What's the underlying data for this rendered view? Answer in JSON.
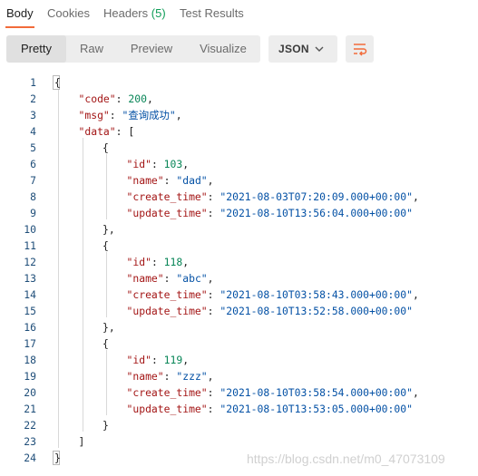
{
  "tabs": [
    {
      "label": "Body",
      "count": ""
    },
    {
      "label": "Cookies",
      "count": ""
    },
    {
      "label": "Headers",
      "count": "(5)"
    },
    {
      "label": "Test Results",
      "count": ""
    }
  ],
  "view_modes": [
    "Pretty",
    "Raw",
    "Preview",
    "Visualize"
  ],
  "active_view": "Pretty",
  "format_select": {
    "value": "JSON"
  },
  "icons": {
    "format_chevron": "chevron-down-icon",
    "wrap": "wrap-lines-icon"
  },
  "colors": {
    "accent": "#f26b3a",
    "count": "#0f9d58",
    "key": "#a31515",
    "string": "#0451a5",
    "number": "#098658"
  },
  "code_lines": [
    {
      "n": "1",
      "indent": 0,
      "tokens": [
        [
          "p",
          "{"
        ]
      ]
    },
    {
      "n": "2",
      "indent": 1,
      "tokens": [
        [
          "k",
          "\"code\""
        ],
        [
          "p",
          ": "
        ],
        [
          "n",
          "200"
        ],
        [
          "p",
          ","
        ]
      ]
    },
    {
      "n": "3",
      "indent": 1,
      "tokens": [
        [
          "k",
          "\"msg\""
        ],
        [
          "p",
          ": "
        ],
        [
          "s",
          "\"查询成功\""
        ],
        [
          "p",
          ","
        ]
      ]
    },
    {
      "n": "4",
      "indent": 1,
      "tokens": [
        [
          "k",
          "\"data\""
        ],
        [
          "p",
          ": ["
        ]
      ]
    },
    {
      "n": "5",
      "indent": 2,
      "tokens": [
        [
          "p",
          "{"
        ]
      ]
    },
    {
      "n": "6",
      "indent": 3,
      "tokens": [
        [
          "k",
          "\"id\""
        ],
        [
          "p",
          ": "
        ],
        [
          "n",
          "103"
        ],
        [
          "p",
          ","
        ]
      ]
    },
    {
      "n": "7",
      "indent": 3,
      "tokens": [
        [
          "k",
          "\"name\""
        ],
        [
          "p",
          ": "
        ],
        [
          "s",
          "\"dad\""
        ],
        [
          "p",
          ","
        ]
      ]
    },
    {
      "n": "8",
      "indent": 3,
      "tokens": [
        [
          "k",
          "\"create_time\""
        ],
        [
          "p",
          ": "
        ],
        [
          "s",
          "\"2021-08-03T07:20:09.000+00:00\""
        ],
        [
          "p",
          ","
        ]
      ]
    },
    {
      "n": "9",
      "indent": 3,
      "tokens": [
        [
          "k",
          "\"update_time\""
        ],
        [
          "p",
          ": "
        ],
        [
          "s",
          "\"2021-08-10T13:56:04.000+00:00\""
        ]
      ]
    },
    {
      "n": "10",
      "indent": 2,
      "tokens": [
        [
          "p",
          "},"
        ]
      ]
    },
    {
      "n": "11",
      "indent": 2,
      "tokens": [
        [
          "p",
          "{"
        ]
      ]
    },
    {
      "n": "12",
      "indent": 3,
      "tokens": [
        [
          "k",
          "\"id\""
        ],
        [
          "p",
          ": "
        ],
        [
          "n",
          "118"
        ],
        [
          "p",
          ","
        ]
      ]
    },
    {
      "n": "13",
      "indent": 3,
      "tokens": [
        [
          "k",
          "\"name\""
        ],
        [
          "p",
          ": "
        ],
        [
          "s",
          "\"abc\""
        ],
        [
          "p",
          ","
        ]
      ]
    },
    {
      "n": "14",
      "indent": 3,
      "tokens": [
        [
          "k",
          "\"create_time\""
        ],
        [
          "p",
          ": "
        ],
        [
          "s",
          "\"2021-08-10T03:58:43.000+00:00\""
        ],
        [
          "p",
          ","
        ]
      ]
    },
    {
      "n": "15",
      "indent": 3,
      "tokens": [
        [
          "k",
          "\"update_time\""
        ],
        [
          "p",
          ": "
        ],
        [
          "s",
          "\"2021-08-10T13:52:58.000+00:00\""
        ]
      ]
    },
    {
      "n": "16",
      "indent": 2,
      "tokens": [
        [
          "p",
          "},"
        ]
      ]
    },
    {
      "n": "17",
      "indent": 2,
      "tokens": [
        [
          "p",
          "{"
        ]
      ]
    },
    {
      "n": "18",
      "indent": 3,
      "tokens": [
        [
          "k",
          "\"id\""
        ],
        [
          "p",
          ": "
        ],
        [
          "n",
          "119"
        ],
        [
          "p",
          ","
        ]
      ]
    },
    {
      "n": "19",
      "indent": 3,
      "tokens": [
        [
          "k",
          "\"name\""
        ],
        [
          "p",
          ": "
        ],
        [
          "s",
          "\"zzz\""
        ],
        [
          "p",
          ","
        ]
      ]
    },
    {
      "n": "20",
      "indent": 3,
      "tokens": [
        [
          "k",
          "\"create_time\""
        ],
        [
          "p",
          ": "
        ],
        [
          "s",
          "\"2021-08-10T03:58:54.000+00:00\""
        ],
        [
          "p",
          ","
        ]
      ]
    },
    {
      "n": "21",
      "indent": 3,
      "tokens": [
        [
          "k",
          "\"update_time\""
        ],
        [
          "p",
          ": "
        ],
        [
          "s",
          "\"2021-08-10T13:53:05.000+00:00\""
        ]
      ]
    },
    {
      "n": "22",
      "indent": 2,
      "tokens": [
        [
          "p",
          "}"
        ]
      ]
    },
    {
      "n": "23",
      "indent": 1,
      "tokens": [
        [
          "p",
          "]"
        ]
      ]
    },
    {
      "n": "24",
      "indent": 0,
      "tokens": [
        [
          "p",
          "}"
        ]
      ]
    }
  ],
  "watermark": "https://blog.csdn.net/m0_47073109"
}
